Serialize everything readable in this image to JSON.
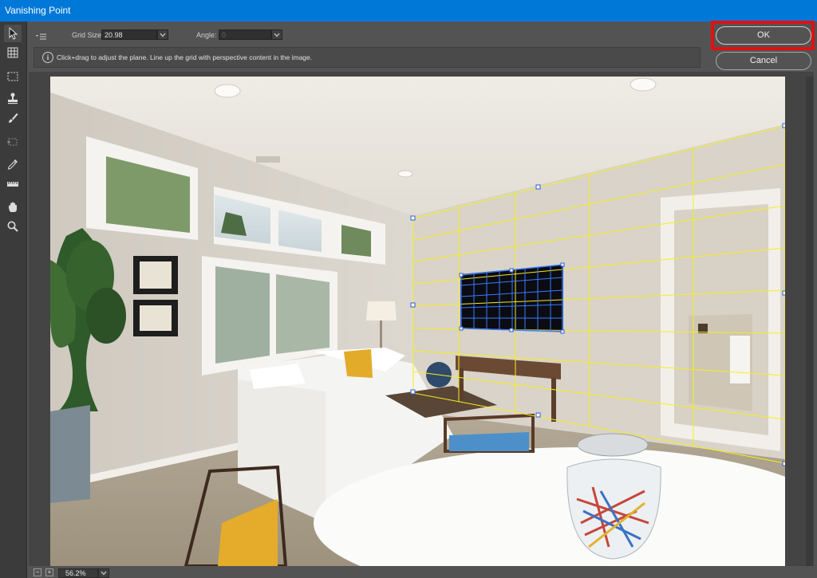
{
  "window": {
    "title": "Vanishing Point"
  },
  "options": {
    "menu_icon": "flyout-menu-icon",
    "grid_size_label": "Grid Size:",
    "grid_size_value": "20.98",
    "angle_label": "Angle:",
    "angle_value": "0"
  },
  "info": {
    "icon": "info-icon",
    "icon_glyph": "i",
    "message": "Click+drag to adjust the plane. Line up the grid with perspective content in the image."
  },
  "buttons": {
    "ok": "OK",
    "cancel": "Cancel"
  },
  "tools": [
    {
      "name": "edit-plane-tool-icon",
      "active": true
    },
    {
      "name": "create-plane-tool-icon"
    },
    {
      "name": "marquee-tool-icon"
    },
    {
      "name": "stamp-tool-icon"
    },
    {
      "name": "brush-tool-icon"
    },
    {
      "name": "transform-tool-icon"
    },
    {
      "name": "eyedropper-tool-icon"
    },
    {
      "name": "measure-tool-icon"
    },
    {
      "name": "hand-tool-icon"
    },
    {
      "name": "zoom-tool-icon"
    }
  ],
  "status": {
    "zoom_level": "56.2%",
    "zoom_out": "−",
    "zoom_in": "+"
  },
  "colors": {
    "title_bar": "#0078d7",
    "grid_line": "#f5ee1c",
    "highlight": "#e01010",
    "tv_grid": "#3b7bff"
  }
}
